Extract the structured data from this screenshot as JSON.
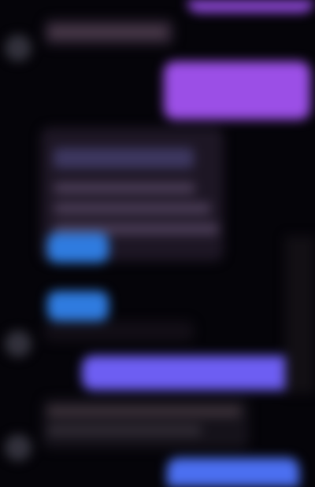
{
  "colors": {
    "background": "#050409",
    "outgoing_violet": "#9b4fe6",
    "outgoing_indigo": "#6d5ef2",
    "outgoing_blue": "#4b6ff0",
    "incoming_card": "#1d1624",
    "action_button": "#2f7bdf",
    "avatar": "#3b3a45"
  },
  "messages": [
    {
      "sender": "self",
      "text": ""
    },
    {
      "sender": "other",
      "text": ""
    },
    {
      "sender": "self",
      "text": ""
    },
    {
      "sender": "other",
      "card": {
        "title": "",
        "lines": [
          "",
          "",
          ""
        ],
        "buttons": [
          "",
          ""
        ]
      }
    },
    {
      "sender": "other",
      "text": ""
    },
    {
      "sender": "self",
      "text": ""
    },
    {
      "sender": "other",
      "text": ""
    },
    {
      "sender": "self",
      "text": ""
    }
  ]
}
